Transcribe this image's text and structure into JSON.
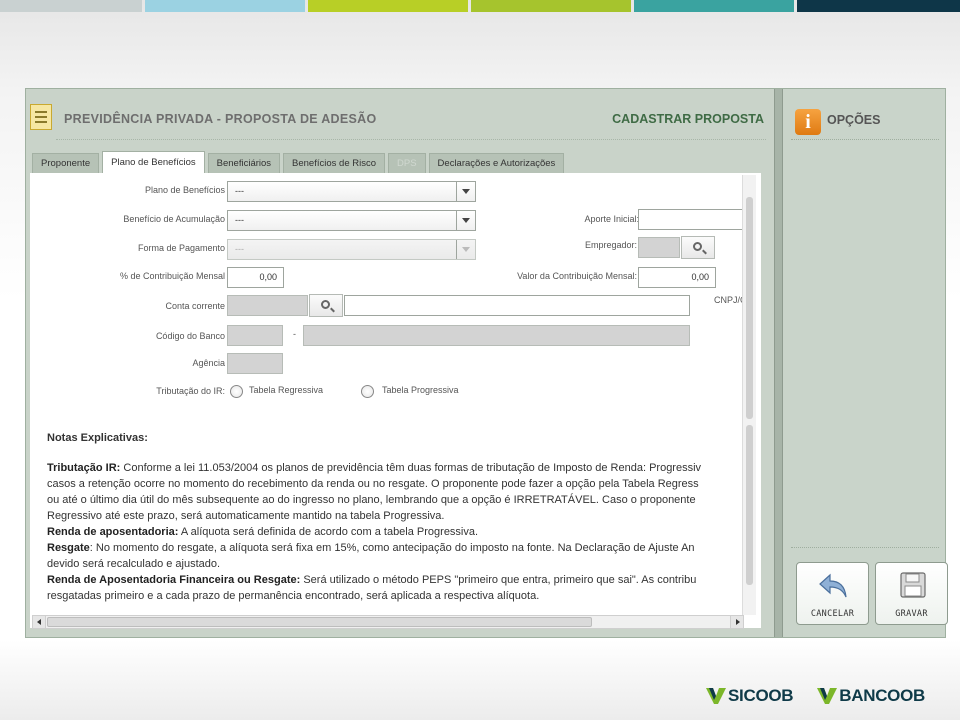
{
  "colors": {
    "stripes": [
      "#c9d1d1",
      "#9bd2e2",
      "#b8cf26",
      "#a6c42d",
      "#3aa3a0",
      "#0e3648"
    ],
    "logo_green": "#7cb72a",
    "logo_teal": "#0f3a48"
  },
  "header": {
    "title": "PREVIDÊNCIA PRIVADA - PROPOSTA DE ADESÃO",
    "action": "CADASTRAR PROPOSTA"
  },
  "tabs": [
    {
      "label": "Proponente",
      "state": "normal"
    },
    {
      "label": "Plano de Benefícios",
      "state": "active"
    },
    {
      "label": "Beneficiários",
      "state": "normal"
    },
    {
      "label": "Benefícios de Risco",
      "state": "normal"
    },
    {
      "label": "DPS",
      "state": "disabled"
    },
    {
      "label": "Declarações e Autorizações",
      "state": "normal"
    }
  ],
  "form": {
    "plano_label": "Plano de Benefícios",
    "plano_value": "---",
    "beneficio_label": "Benefício de Acumulação",
    "beneficio_value": "---",
    "forma_label": "Forma de Pagamento",
    "forma_value": "---",
    "contrib_label": "% de Contribuição Mensal",
    "contrib_value": "0,00",
    "conta_label": "Conta corrente",
    "codigo_banco_label": "Código do Banco",
    "codigo_sep": "-",
    "agencia_label": "Agência",
    "tributacao_label": "Tributação do IR:",
    "tabela_regressiva": "Tabela Regressiva",
    "tabela_progressiva": "Tabela Progressiva",
    "aporte_label": "Aporte Inicial:",
    "empregador_label": "Empregador:",
    "valor_contrib_label": "Valor da Contribuição Mensal:",
    "valor_contrib_value": "0,00",
    "cnpj_label": "CNPJ/C"
  },
  "notes": {
    "title": "Notas Explicativas:",
    "line1_bold": "Tributação IR:",
    "line1": " Conforme a lei 11.053/2004 os planos de previdência têm duas formas de tributação de Imposto de Renda: Progressiv",
    "line2": "casos a retenção ocorre no momento do recebimento da renda ou no resgate. O proponente pode fazer a opção pela Tabela Regress",
    "line3": "ou até o último dia útil do mês subsequente ao do ingresso no plano, lembrando que a opção é IRRETRATÁVEL. Caso o proponente",
    "line4": "Regressivo até este prazo, será automaticamente mantido na tabela Progressiva.",
    "line5_bold": "Renda de aposentadoria:",
    "line5": " A alíquota será definida de acordo com a tabela Progressiva.",
    "line6_bold": "Resgate",
    "line6": ": No momento do resgate, a alíquota será fixa em 15%, como antecipação do imposto na fonte. Na Declaração de Ajuste An",
    "line7": "devido será recalculado e ajustado.",
    "line8_bold": "Renda de Aposentadoria Financeira ou Resgate:",
    "line8": " Será utilizado o método PEPS \"primeiro que entra, primeiro que sai\". As contribu",
    "line9": "resgatadas primeiro e a cada prazo de permanência encontrado, será aplicada a respectiva alíquota."
  },
  "side": {
    "title": "OPÇÕES",
    "cancel_label": "CANCELAR",
    "save_label": "GRAVAR"
  },
  "logos": {
    "sicoob": "SICOOB",
    "bancoob": "BANCOOB"
  }
}
